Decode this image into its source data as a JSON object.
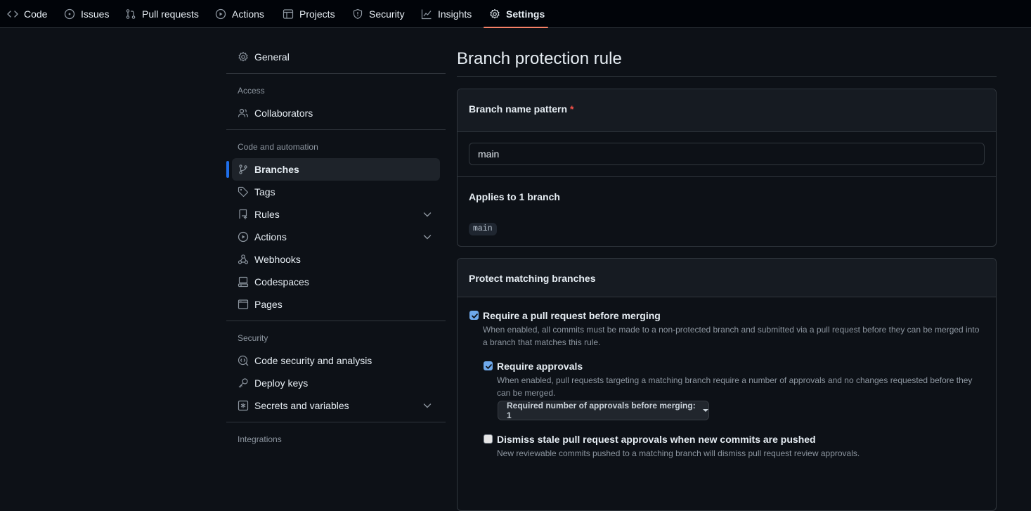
{
  "topnav": {
    "tabs": [
      {
        "label": "Code",
        "icon": "code-icon"
      },
      {
        "label": "Issues",
        "icon": "issue-opened-icon"
      },
      {
        "label": "Pull requests",
        "icon": "git-pull-request-icon"
      },
      {
        "label": "Actions",
        "icon": "play-icon"
      },
      {
        "label": "Projects",
        "icon": "table-icon"
      },
      {
        "label": "Security",
        "icon": "shield-icon"
      },
      {
        "label": "Insights",
        "icon": "graph-icon"
      },
      {
        "label": "Settings",
        "icon": "gear-icon",
        "active": true
      }
    ]
  },
  "sidebar": {
    "general": "General",
    "sections": {
      "access": "Access",
      "code_automation": "Code and automation",
      "security": "Security",
      "integrations": "Integrations"
    },
    "items": {
      "collaborators": "Collaborators",
      "branches": "Branches",
      "tags": "Tags",
      "rules": "Rules",
      "actions": "Actions",
      "webhooks": "Webhooks",
      "codespaces": "Codespaces",
      "pages": "Pages",
      "code_security": "Code security and analysis",
      "deploy_keys": "Deploy keys",
      "secrets": "Secrets and variables"
    }
  },
  "main": {
    "title": "Branch protection rule",
    "pattern_box": {
      "label": "Branch name pattern",
      "required_mark": "*",
      "value": "main",
      "applies_label": "Applies to 1 branch",
      "branch_chip": "main"
    },
    "protect_box": {
      "title": "Protect matching branches",
      "options": {
        "require_pr": {
          "label": "Require a pull request before merging",
          "checked": true,
          "desc_line1": "When enabled, all commits must be made to a non-protected branch and submitted via a pull request before they can be merged into",
          "desc_line2": "a branch that matches this rule."
        },
        "require_approvals": {
          "label": "Require approvals",
          "checked": true,
          "desc_line1": "When enabled, pull requests targeting a matching branch require a number of approvals and no changes requested before they",
          "desc_line2": "can be merged.",
          "select_label": "Required number of approvals before merging: 1"
        },
        "dismiss_stale": {
          "label": "Dismiss stale pull request approvals when new commits are pushed",
          "checked": false,
          "desc_line1": "New reviewable commits pushed to a matching branch will dismiss pull request review approvals."
        }
      }
    }
  },
  "colors": {
    "background": "#0d1117",
    "accent_underline": "#f78166",
    "active_bar": "#1f6feb",
    "checkbox_checked": "#6ea9ec",
    "required_mark": "#f85149"
  }
}
